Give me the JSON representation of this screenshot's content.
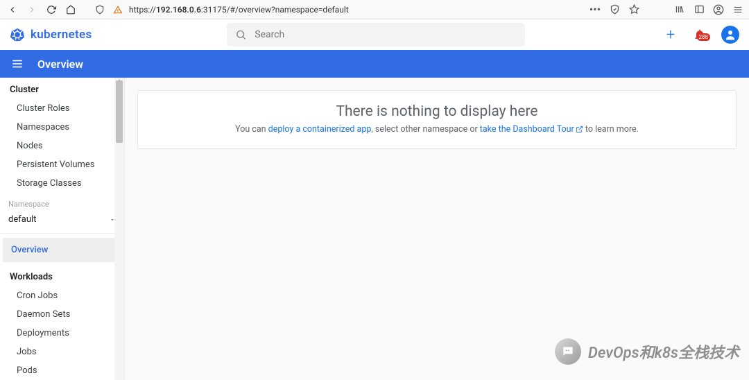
{
  "browser": {
    "url_prefix": "https://",
    "url_host": "192.168.0.6",
    "url_rest": ":31175/#/overview?namespace=default"
  },
  "header": {
    "brand": "kubernetes",
    "search_placeholder": "Search",
    "notification_count": "288"
  },
  "bluebar": {
    "title": "Overview"
  },
  "sidebar": {
    "cluster_label": "Cluster",
    "cluster_items": [
      "Cluster Roles",
      "Namespaces",
      "Nodes",
      "Persistent Volumes",
      "Storage Classes"
    ],
    "namespace_label": "Namespace",
    "namespace_selected": "default",
    "overview_label": "Overview",
    "workloads_label": "Workloads",
    "workloads_items": [
      "Cron Jobs",
      "Daemon Sets",
      "Deployments",
      "Jobs",
      "Pods"
    ]
  },
  "content": {
    "empty_title": "There is nothing to display here",
    "empty_pre": "You can ",
    "empty_link1": "deploy a containerized app",
    "empty_mid": ", select other namespace or ",
    "empty_link2": "take the Dashboard Tour",
    "empty_post": " to learn more."
  },
  "watermark": {
    "text": "DevOps和k8s全栈技术"
  }
}
